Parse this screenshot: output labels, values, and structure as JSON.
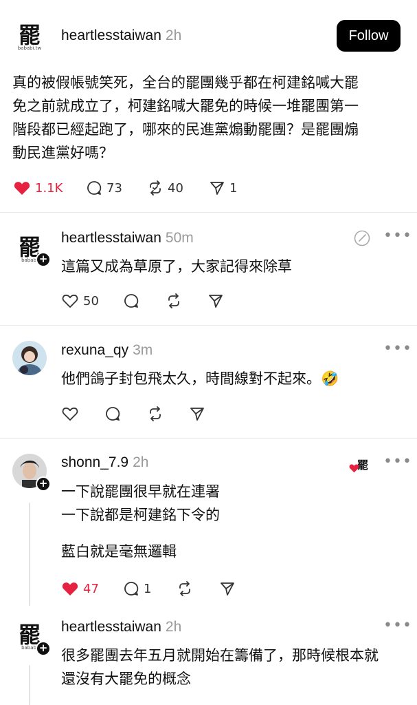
{
  "post": {
    "username": "heartlesstaiwan",
    "time": "2h",
    "follow_label": "Follow",
    "avatar_logo": {
      "glyph": "罷",
      "sub": "bababi.tw"
    },
    "text_lines": [
      "真的被假帳號笑死，全台的罷團幾乎都在柯建銘喊大罷",
      "免之前就成立了，柯建銘喊大罷免的時候一堆罷團第一",
      "階段都已經起跑了，哪來的民進黨煽動罷團？是罷團煽",
      "動民進黨好嗎？"
    ],
    "likes": "1.1K",
    "comments": "73",
    "reposts": "40",
    "shares": "1"
  },
  "replies": [
    {
      "username": "heartlesstaiwan",
      "time": "50m",
      "avatar_logo": {
        "glyph": "罷",
        "sub": "bababi"
      },
      "text_lines": [
        "這篇又成為草原了，大家記得來除草"
      ],
      "likes": "50"
    },
    {
      "username": "rexuna_qy",
      "time": "3m",
      "text_lines": [
        "他們鴿子封包飛太久，時間線對不起來。🤣"
      ]
    },
    {
      "username": "shonn_7.9",
      "time": "2h",
      "text_lines": [
        "一下說罷團很早就在連署",
        "一下說都是柯建銘下令的"
      ],
      "text_lines_2": [
        "藍白就是毫無邏輯"
      ],
      "likes": "47",
      "comments": "1",
      "liked_by_logo": "罷"
    },
    {
      "username": "heartlesstaiwan",
      "time": "2h",
      "avatar_logo": {
        "glyph": "罷",
        "sub": "bababi"
      },
      "text_lines": [
        "很多罷團去年五月就開始在籌備了，那時候根本就",
        "還沒有大罷免的概念"
      ]
    }
  ],
  "colors": {
    "like_red": "#e5223f",
    "follow_bg": "#000000"
  }
}
